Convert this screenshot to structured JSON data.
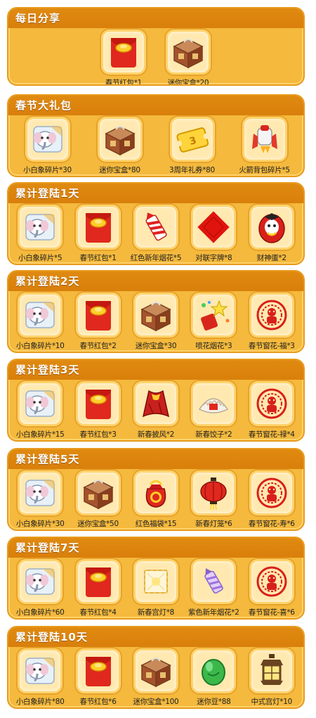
{
  "sections": [
    {
      "title": "每日分享",
      "items": [
        {
          "icon": "red-envelope-icon",
          "label": "春节红包*1"
        },
        {
          "icon": "treasure-box-icon",
          "label": "迷你宝盒*20"
        }
      ]
    },
    {
      "title": "春节大礼包",
      "items": [
        {
          "icon": "elephant-fragment-icon",
          "label": "小白象碎片*30"
        },
        {
          "icon": "treasure-box-icon",
          "label": "迷你宝盒*80"
        },
        {
          "icon": "anniversary-coupon-icon",
          "label": "3周年礼券*80"
        },
        {
          "icon": "rocket-backpack-fragment-icon",
          "label": "火箭背包碎片*5"
        }
      ]
    },
    {
      "title": "累计登陆1天",
      "items": [
        {
          "icon": "elephant-fragment-icon",
          "label": "小白象碎片*5"
        },
        {
          "icon": "red-envelope-icon",
          "label": "春节红包*1"
        },
        {
          "icon": "red-firework-icon",
          "label": "红色新年烟花*5"
        },
        {
          "icon": "couplet-character-icon",
          "label": "对联字牌*8"
        },
        {
          "icon": "fortune-egg-icon",
          "label": "财神蛋*2"
        }
      ]
    },
    {
      "title": "累计登陆2天",
      "items": [
        {
          "icon": "elephant-fragment-icon",
          "label": "小白象碎片*10"
        },
        {
          "icon": "red-envelope-icon",
          "label": "春节红包*2"
        },
        {
          "icon": "treasure-box-icon",
          "label": "迷你宝盒*30"
        },
        {
          "icon": "fountain-firework-icon",
          "label": "喷花烟花*3"
        },
        {
          "icon": "window-paper-cut-icon",
          "label": "春节窗花-福*3"
        }
      ]
    },
    {
      "title": "累计登陆3天",
      "items": [
        {
          "icon": "elephant-fragment-icon",
          "label": "小白象碎片*15"
        },
        {
          "icon": "red-envelope-icon",
          "label": "春节红包*3"
        },
        {
          "icon": "cape-icon",
          "label": "新春披风*2"
        },
        {
          "icon": "dumpling-icon",
          "label": "新春饺子*2"
        },
        {
          "icon": "window-paper-cut-icon",
          "label": "春节窗花-禄*4"
        }
      ]
    },
    {
      "title": "累计登陆5天",
      "items": [
        {
          "icon": "elephant-fragment-icon",
          "label": "小白象碎片*30"
        },
        {
          "icon": "treasure-box-icon",
          "label": "迷你宝盒*50"
        },
        {
          "icon": "lucky-bag-icon",
          "label": "红色福袋*15"
        },
        {
          "icon": "lantern-icon",
          "label": "新春灯笼*6"
        },
        {
          "icon": "window-paper-cut-icon",
          "label": "春节窗花-寿*6"
        }
      ]
    },
    {
      "title": "累计登陆7天",
      "items": [
        {
          "icon": "elephant-fragment-icon",
          "label": "小白象碎片*60"
        },
        {
          "icon": "red-envelope-icon",
          "label": "春节红包*4"
        },
        {
          "icon": "palace-lantern-icon",
          "label": "新春宫灯*8"
        },
        {
          "icon": "purple-firework-icon",
          "label": "紫色新年烟花*2"
        },
        {
          "icon": "window-paper-cut-icon",
          "label": "春节窗花-喜*6"
        }
      ]
    },
    {
      "title": "累计登陆10天",
      "items": [
        {
          "icon": "elephant-fragment-icon",
          "label": "小白象碎片*80"
        },
        {
          "icon": "red-envelope-icon",
          "label": "春节红包*6"
        },
        {
          "icon": "treasure-box-icon",
          "label": "迷你宝盒*100"
        },
        {
          "icon": "mini-bean-icon",
          "label": "迷你豆*88"
        },
        {
          "icon": "chinese-lantern-icon",
          "label": "中式宫灯*10"
        }
      ]
    }
  ]
}
